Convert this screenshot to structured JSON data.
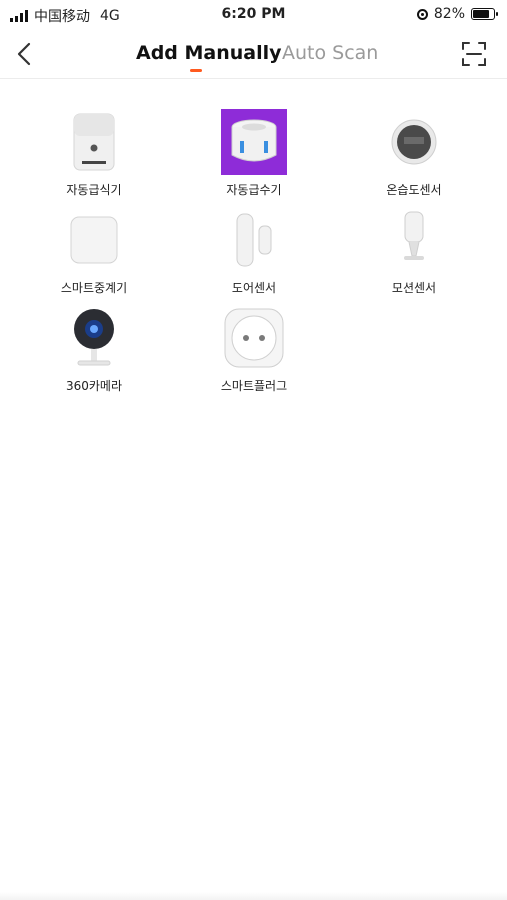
{
  "status_bar": {
    "carrier": "中国移动",
    "network": "4G",
    "time": "6:20 PM",
    "battery": "82%",
    "battery_level": 0.82
  },
  "nav": {
    "tab_active": "Add Manually",
    "tab_inactive": "Auto Scan",
    "accent_color": "#ff5a1f"
  },
  "devices": [
    {
      "label": "자동급식기",
      "icon": "pet-feeder-icon"
    },
    {
      "label": "자동급수기",
      "icon": "water-fountain-icon",
      "selected": true,
      "highlight_color": "#8e2cd8"
    },
    {
      "label": "온습도센서",
      "icon": "temp-humidity-sensor-icon"
    },
    {
      "label": "스마트중계기",
      "icon": "hub-icon"
    },
    {
      "label": "도어센서",
      "icon": "door-sensor-icon"
    },
    {
      "label": "모션센서",
      "icon": "motion-sensor-icon"
    },
    {
      "label": "360카메라",
      "icon": "camera-icon"
    },
    {
      "label": "스마트플러그",
      "icon": "smart-plug-icon"
    }
  ]
}
